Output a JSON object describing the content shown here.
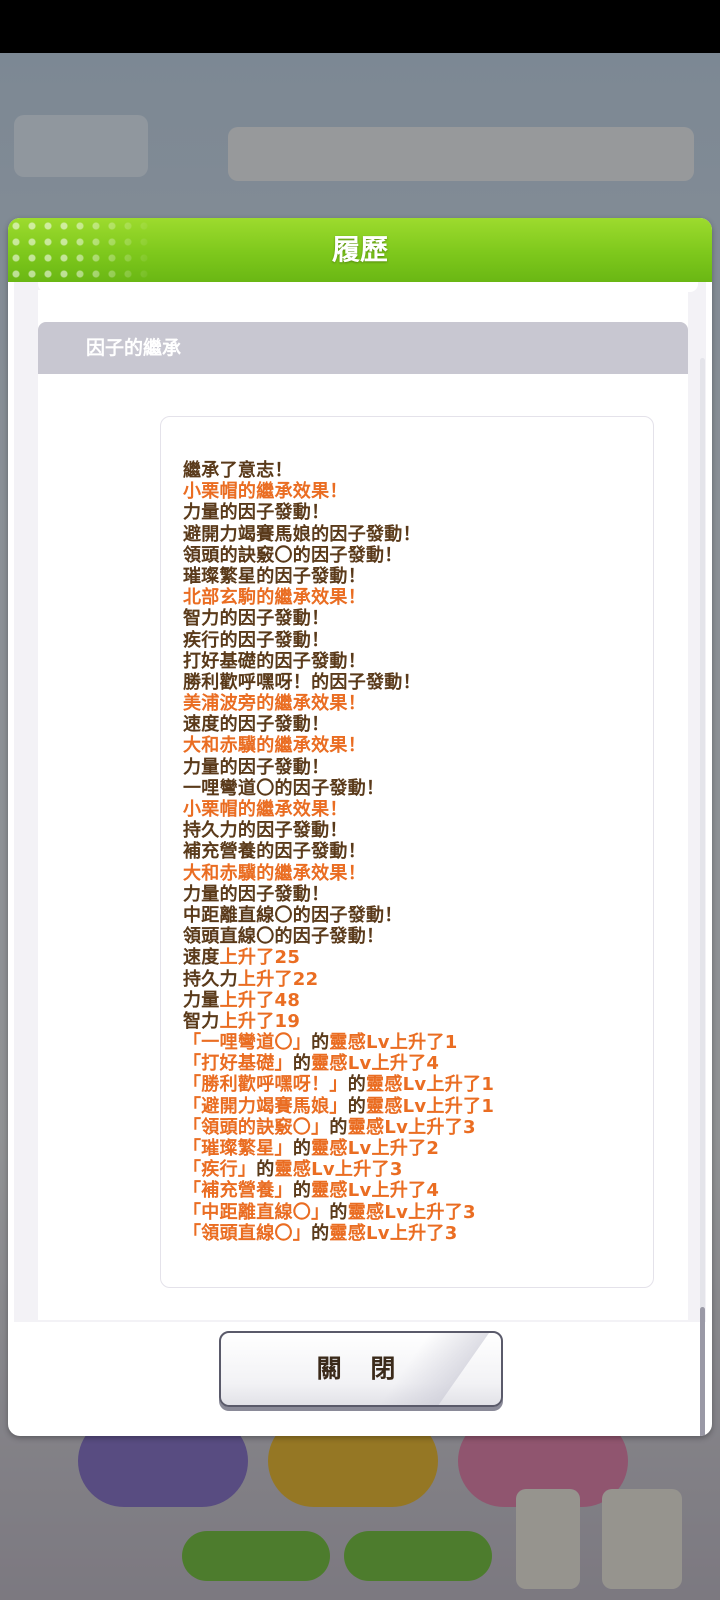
{
  "dialog": {
    "title": "履歷",
    "section_title": "因子的繼承",
    "close_label": "關 閉"
  },
  "log_lines": [
    {
      "segments": [
        {
          "text": "繼承了意志！",
          "color": "dark"
        }
      ]
    },
    {
      "segments": [
        {
          "text": "小栗帽的繼承效果！",
          "color": "orange"
        }
      ]
    },
    {
      "segments": [
        {
          "text": "力量的因子發動！",
          "color": "dark"
        }
      ]
    },
    {
      "segments": [
        {
          "text": "避開力竭賽馬娘的因子發動！",
          "color": "dark"
        }
      ]
    },
    {
      "segments": [
        {
          "text": "領頭的訣竅〇的因子發動！",
          "color": "dark"
        }
      ]
    },
    {
      "segments": [
        {
          "text": "璀璨繁星的因子發動！",
          "color": "dark"
        }
      ]
    },
    {
      "segments": [
        {
          "text": "北部玄駒的繼承效果！",
          "color": "orange"
        }
      ]
    },
    {
      "segments": [
        {
          "text": "智力的因子發動！",
          "color": "dark"
        }
      ]
    },
    {
      "segments": [
        {
          "text": "疾行的因子發動！",
          "color": "dark"
        }
      ]
    },
    {
      "segments": [
        {
          "text": "打好基礎的因子發動！",
          "color": "dark"
        }
      ]
    },
    {
      "segments": [
        {
          "text": "勝利歡呼嘿呀！的因子發動！",
          "color": "dark"
        }
      ]
    },
    {
      "segments": [
        {
          "text": "美浦波旁的繼承效果！",
          "color": "orange"
        }
      ]
    },
    {
      "segments": [
        {
          "text": "速度的因子發動！",
          "color": "dark"
        }
      ]
    },
    {
      "segments": [
        {
          "text": "大和赤驥的繼承效果！",
          "color": "orange"
        }
      ]
    },
    {
      "segments": [
        {
          "text": "力量的因子發動！",
          "color": "dark"
        }
      ]
    },
    {
      "segments": [
        {
          "text": "一哩彎道〇的因子發動！",
          "color": "dark"
        }
      ]
    },
    {
      "segments": [
        {
          "text": "小栗帽的繼承效果！",
          "color": "orange"
        }
      ]
    },
    {
      "segments": [
        {
          "text": "持久力的因子發動！",
          "color": "dark"
        }
      ]
    },
    {
      "segments": [
        {
          "text": "補充營養的因子發動！",
          "color": "dark"
        }
      ]
    },
    {
      "segments": [
        {
          "text": "大和赤驥的繼承效果！",
          "color": "orange"
        }
      ]
    },
    {
      "segments": [
        {
          "text": "力量的因子發動！",
          "color": "dark"
        }
      ]
    },
    {
      "segments": [
        {
          "text": "中距離直線〇的因子發動！",
          "color": "dark"
        }
      ]
    },
    {
      "segments": [
        {
          "text": "領頭直線〇的因子發動！",
          "color": "dark"
        }
      ]
    },
    {
      "segments": [
        {
          "text": "速度",
          "color": "dark"
        },
        {
          "text": "上升了25",
          "color": "orange"
        }
      ]
    },
    {
      "segments": [
        {
          "text": "持久力",
          "color": "dark"
        },
        {
          "text": "上升了22",
          "color": "orange"
        }
      ]
    },
    {
      "segments": [
        {
          "text": "力量",
          "color": "dark"
        },
        {
          "text": "上升了48",
          "color": "orange"
        }
      ]
    },
    {
      "segments": [
        {
          "text": "智力",
          "color": "dark"
        },
        {
          "text": "上升了19",
          "color": "orange"
        }
      ]
    },
    {
      "segments": [
        {
          "text": "「一哩彎道〇」",
          "color": "orange"
        },
        {
          "text": "的",
          "color": "dark"
        },
        {
          "text": "靈感Lv上升了1",
          "color": "orange"
        }
      ]
    },
    {
      "segments": [
        {
          "text": "「打好基礎」",
          "color": "orange"
        },
        {
          "text": "的",
          "color": "dark"
        },
        {
          "text": "靈感Lv上升了4",
          "color": "orange"
        }
      ]
    },
    {
      "segments": [
        {
          "text": "「勝利歡呼嘿呀！」",
          "color": "orange"
        },
        {
          "text": "的",
          "color": "dark"
        },
        {
          "text": "靈感Lv上升了1",
          "color": "orange"
        }
      ]
    },
    {
      "segments": [
        {
          "text": "「避開力竭賽馬娘」",
          "color": "orange"
        },
        {
          "text": "的",
          "color": "dark"
        },
        {
          "text": "靈感Lv上升了1",
          "color": "orange"
        }
      ]
    },
    {
      "segments": [
        {
          "text": "「領頭的訣竅〇」",
          "color": "orange"
        },
        {
          "text": "的",
          "color": "dark"
        },
        {
          "text": "靈感Lv上升了3",
          "color": "orange"
        }
      ]
    },
    {
      "segments": [
        {
          "text": "「璀璨繁星」",
          "color": "orange"
        },
        {
          "text": "的",
          "color": "dark"
        },
        {
          "text": "靈感Lv上升了2",
          "color": "orange"
        }
      ]
    },
    {
      "segments": [
        {
          "text": "「疾行」",
          "color": "orange"
        },
        {
          "text": "的",
          "color": "dark"
        },
        {
          "text": "靈感Lv上升了3",
          "color": "orange"
        }
      ]
    },
    {
      "segments": [
        {
          "text": "「補充營養」",
          "color": "orange"
        },
        {
          "text": "的",
          "color": "dark"
        },
        {
          "text": "靈感Lv上升了4",
          "color": "orange"
        }
      ]
    },
    {
      "segments": [
        {
          "text": "「中距離直線〇」",
          "color": "orange"
        },
        {
          "text": "的",
          "color": "dark"
        },
        {
          "text": "靈感Lv上升了3",
          "color": "orange"
        }
      ]
    },
    {
      "segments": [
        {
          "text": "「領頭直線〇」",
          "color": "orange"
        },
        {
          "text": "的",
          "color": "dark"
        },
        {
          "text": "靈感Lv上升了3",
          "color": "orange"
        }
      ]
    }
  ],
  "colors": {
    "header_green": "#7ec81c",
    "dark_text": "#5a3a1a",
    "orange_text": "#ea6d22",
    "section_bar": "#c8c7d1"
  }
}
